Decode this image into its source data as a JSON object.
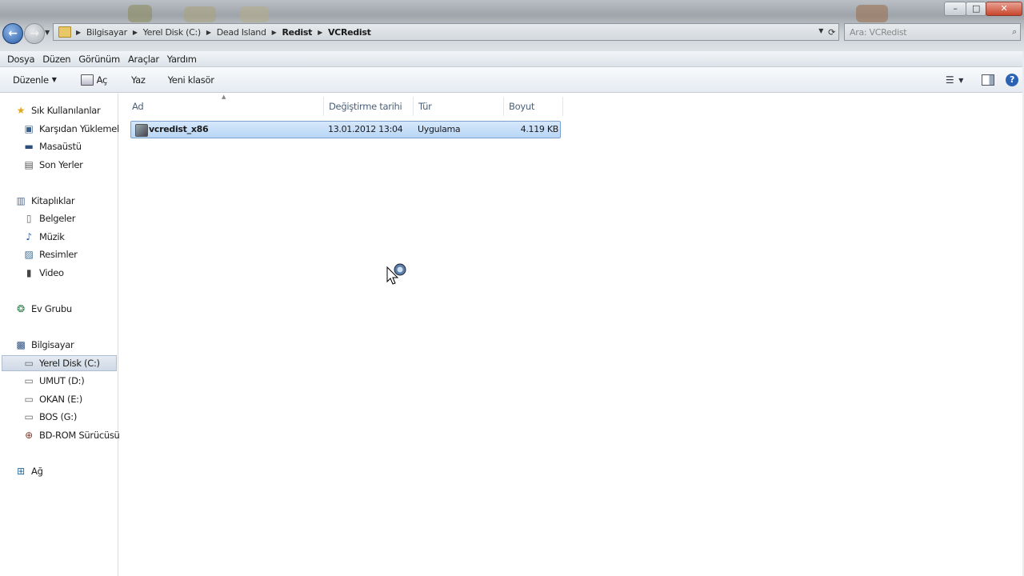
{
  "window": {
    "controls": [
      "–",
      "□",
      "✕"
    ]
  },
  "address": {
    "crumbs": [
      "Bilgisayar",
      "Yerel Disk (C:)",
      "Dead Island",
      "Redist",
      "VCRedist"
    ],
    "search_placeholder": "Ara: VCRedist"
  },
  "menu": [
    "Dosya",
    "Düzen",
    "Görünüm",
    "Araçlar",
    "Yardım"
  ],
  "commands": {
    "organize": "Düzenle",
    "open": "Aç",
    "write": "Yaz",
    "new_folder": "Yeni klasör"
  },
  "nav": {
    "favorites": {
      "header": "Sık Kullanılanlar",
      "items": [
        "Karşıdan Yüklemeler",
        "Masaüstü",
        "Son Yerler"
      ]
    },
    "libraries": {
      "header": "Kitaplıklar",
      "items": [
        "Belgeler",
        "Müzik",
        "Resimler",
        "Video"
      ]
    },
    "homegroup": "Ev Grubu",
    "computer": {
      "header": "Bilgisayar",
      "items": [
        "Yerel Disk (C:)",
        "UMUT (D:)",
        "OKAN (E:)",
        "BOS (G:)",
        "BD-ROM Sürücüsü ("
      ]
    },
    "network": "Ağ"
  },
  "columns": [
    "Ad",
    "Değiştirme tarihi",
    "Tür",
    "Boyut"
  ],
  "files": [
    {
      "name": "vcredist_x86",
      "modified": "13.01.2012 13:04",
      "type": "Uygulama",
      "size": "4.119 KB"
    }
  ],
  "colors": {
    "selection": "#cde3fa",
    "selection_border": "#7da2ce",
    "header_text": "#4c607a"
  }
}
